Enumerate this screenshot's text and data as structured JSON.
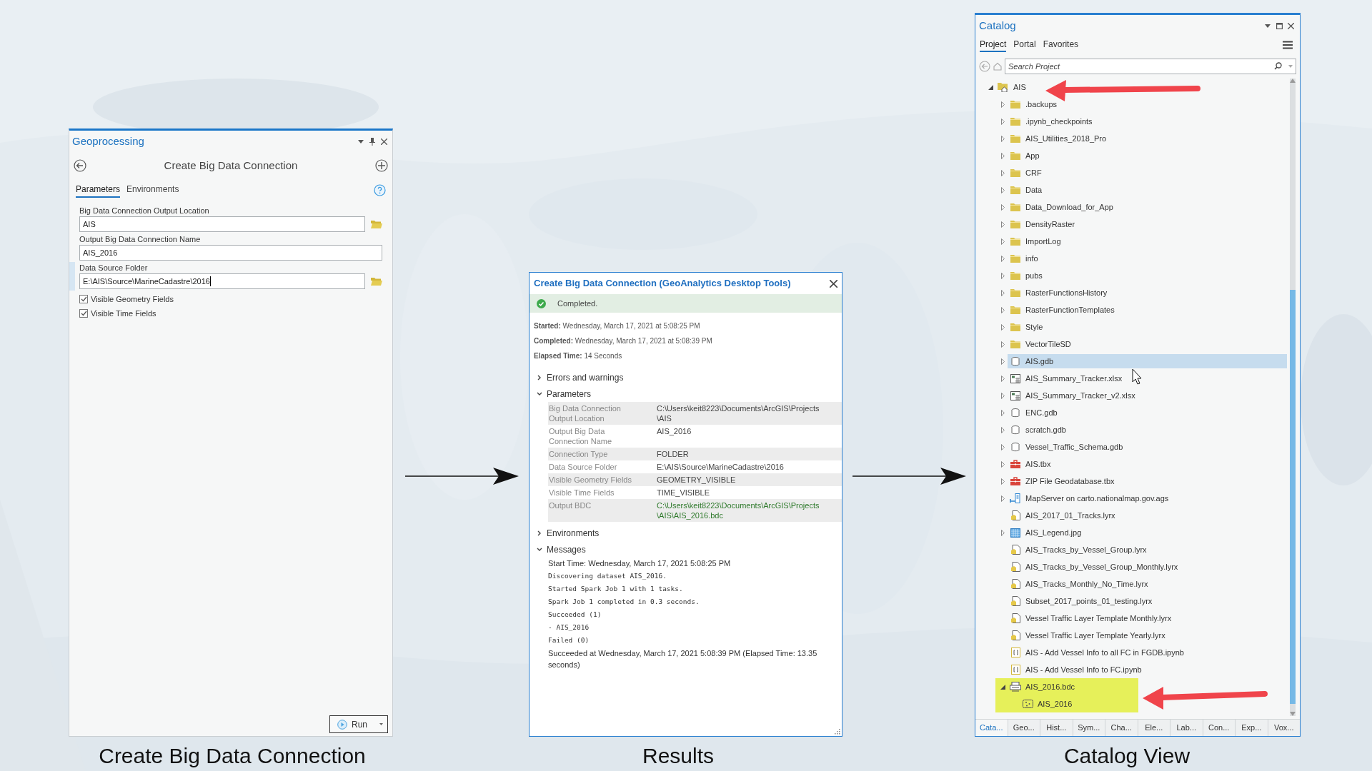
{
  "geoprocessing": {
    "title": "Geoprocessing",
    "tool_title": "Create Big Data Connection",
    "tabs": [
      {
        "label": "Parameters",
        "selected": true
      },
      {
        "label": "Environments",
        "selected": false
      }
    ],
    "parameters": [
      {
        "label": "Big Data Connection Output Location",
        "value": "AIS",
        "browse": true,
        "focused": false
      },
      {
        "label": "Output Big Data Connection Name",
        "value": "AIS_2016",
        "browse": false,
        "focused": false
      },
      {
        "label": "Data Source Folder",
        "value": "E:\\AIS\\Source\\MarineCadastre\\2016",
        "browse": true,
        "focused": true
      }
    ],
    "checkboxes": [
      {
        "label": "Visible Geometry Fields",
        "checked": true
      },
      {
        "label": "Visible Time Fields",
        "checked": true
      }
    ],
    "run_button": "Run"
  },
  "results": {
    "title": "Create Big Data Connection (GeoAnalytics Desktop Tools)",
    "status": "Completed.",
    "summary": [
      {
        "label": "Started:",
        "value": "Wednesday, March 17, 2021 at 5:08:25 PM"
      },
      {
        "label": "Completed:",
        "value": "Wednesday, March 17, 2021 at 5:08:39 PM"
      },
      {
        "label": "Elapsed Time:",
        "value": "14 Seconds"
      }
    ],
    "sections": [
      {
        "label": "Errors and warnings",
        "expanded": false
      },
      {
        "label": "Parameters",
        "expanded": true,
        "kind": "table",
        "rows": [
          {
            "label": "Big Data Connection Output Location",
            "value": "C:\\Users\\keit8223\\Documents\\ArcGIS\\Projects\\AIS",
            "kind": "input"
          },
          {
            "label": "Output Big Data Connection Name",
            "value": "AIS_2016",
            "kind": "input"
          },
          {
            "label": "Connection Type",
            "value": "FOLDER",
            "kind": "input"
          },
          {
            "label": "Data Source Folder",
            "value": "E:\\AIS\\Source\\MarineCadastre\\2016",
            "kind": "input"
          },
          {
            "label": "Visible Geometry Fields",
            "value": "GEOMETRY_VISIBLE",
            "kind": "input"
          },
          {
            "label": "Visible Time Fields",
            "value": "TIME_VISIBLE",
            "kind": "input"
          },
          {
            "label": "Output BDC",
            "value": "C:\\Users\\keit8223\\Documents\\ArcGIS\\Projects\\AIS\\AIS_2016.bdc",
            "kind": "output"
          }
        ]
      },
      {
        "label": "Environments",
        "expanded": false
      },
      {
        "label": "Messages",
        "expanded": true,
        "kind": "messages",
        "messages": [
          {
            "text": "Start Time: Wednesday, March 17, 2021 5:08:25 PM",
            "kind": "text"
          },
          {
            "text": "Discovering dataset AIS_2016.",
            "kind": "mono"
          },
          {
            "text": "Started Spark Job 1 with 1 tasks.",
            "kind": "mono"
          },
          {
            "text": "Spark Job 1 completed in 0.3 seconds.",
            "kind": "mono"
          },
          {
            "text": "Succeeded (1)",
            "kind": "mono"
          },
          {
            "text": "- AIS_2016",
            "kind": "mono"
          },
          {
            "text": "Failed (0)",
            "kind": "mono"
          },
          {
            "text": "Succeeded at Wednesday, March 17, 2021 5:08:39 PM (Elapsed Time: 13.35 seconds)",
            "kind": "text"
          }
        ]
      }
    ]
  },
  "catalog": {
    "title": "Catalog",
    "tabs": [
      {
        "label": "Project",
        "selected": true
      },
      {
        "label": "Portal",
        "selected": false
      },
      {
        "label": "Favorites",
        "selected": false
      }
    ],
    "search": {
      "placeholder": "Search Project"
    },
    "tree": [
      {
        "label": "AIS",
        "kind": "project-folder",
        "has_children": true,
        "expanded": true,
        "selected": false,
        "highlighted": false,
        "children": [
          {
            "label": ".backups",
            "kind": "folder",
            "has_children": true,
            "expanded": false,
            "selected": false,
            "highlighted": false
          },
          {
            "label": ".ipynb_checkpoints",
            "kind": "folder",
            "has_children": true,
            "expanded": false,
            "selected": false,
            "highlighted": false
          },
          {
            "label": "AIS_Utilities_2018_Pro",
            "kind": "folder",
            "has_children": true,
            "expanded": false,
            "selected": false,
            "highlighted": false
          },
          {
            "label": "App",
            "kind": "folder",
            "has_children": true,
            "expanded": false,
            "selected": false,
            "highlighted": false
          },
          {
            "label": "CRF",
            "kind": "folder",
            "has_children": true,
            "expanded": false,
            "selected": false,
            "highlighted": false
          },
          {
            "label": "Data",
            "kind": "folder",
            "has_children": true,
            "expanded": false,
            "selected": false,
            "highlighted": false
          },
          {
            "label": "Data_Download_for_App",
            "kind": "folder",
            "has_children": true,
            "expanded": false,
            "selected": false,
            "highlighted": false
          },
          {
            "label": "DensityRaster",
            "kind": "folder",
            "has_children": true,
            "expanded": false,
            "selected": false,
            "highlighted": false
          },
          {
            "label": "ImportLog",
            "kind": "folder",
            "has_children": true,
            "expanded": false,
            "selected": false,
            "highlighted": false
          },
          {
            "label": "info",
            "kind": "folder",
            "has_children": true,
            "expanded": false,
            "selected": false,
            "highlighted": false
          },
          {
            "label": "pubs",
            "kind": "folder",
            "has_children": true,
            "expanded": false,
            "selected": false,
            "highlighted": false
          },
          {
            "label": "RasterFunctionsHistory",
            "kind": "folder",
            "has_children": true,
            "expanded": false,
            "selected": false,
            "highlighted": false
          },
          {
            "label": "RasterFunctionTemplates",
            "kind": "folder",
            "has_children": true,
            "expanded": false,
            "selected": false,
            "highlighted": false
          },
          {
            "label": "Style",
            "kind": "folder",
            "has_children": true,
            "expanded": false,
            "selected": false,
            "highlighted": false
          },
          {
            "label": "VectorTileSD",
            "kind": "folder",
            "has_children": true,
            "expanded": false,
            "selected": false,
            "highlighted": false
          },
          {
            "label": "AIS.gdb",
            "kind": "gdb",
            "has_children": true,
            "expanded": false,
            "selected": true,
            "highlighted": false
          },
          {
            "label": "AIS_Summary_Tracker.xlsx",
            "kind": "xlsx",
            "has_children": true,
            "expanded": false,
            "selected": false,
            "highlighted": false
          },
          {
            "label": "AIS_Summary_Tracker_v2.xlsx",
            "kind": "xlsx",
            "has_children": true,
            "expanded": false,
            "selected": false,
            "highlighted": false
          },
          {
            "label": "ENC.gdb",
            "kind": "gdb",
            "has_children": true,
            "expanded": false,
            "selected": false,
            "highlighted": false
          },
          {
            "label": "scratch.gdb",
            "kind": "gdb",
            "has_children": true,
            "expanded": false,
            "selected": false,
            "highlighted": false
          },
          {
            "label": "Vessel_Traffic_Schema.gdb",
            "kind": "gdb",
            "has_children": true,
            "expanded": false,
            "selected": false,
            "highlighted": false
          },
          {
            "label": "AIS.tbx",
            "kind": "tbx",
            "has_children": true,
            "expanded": false,
            "selected": false,
            "highlighted": false
          },
          {
            "label": "ZIP File Geodatabase.tbx",
            "kind": "tbx",
            "has_children": true,
            "expanded": false,
            "selected": false,
            "highlighted": false
          },
          {
            "label": "MapServer on carto.nationalmap.gov.ags",
            "kind": "server",
            "has_children": true,
            "expanded": false,
            "selected": false,
            "highlighted": false
          },
          {
            "label": "AIS_2017_01_Tracks.lyrx",
            "kind": "lyrx",
            "has_children": false,
            "selected": false,
            "highlighted": false
          },
          {
            "label": "AIS_Legend.jpg",
            "kind": "jpg",
            "has_children": true,
            "expanded": false,
            "selected": false,
            "highlighted": false
          },
          {
            "label": "AIS_Tracks_by_Vessel_Group.lyrx",
            "kind": "lyrx",
            "has_children": false,
            "selected": false,
            "highlighted": false
          },
          {
            "label": "AIS_Tracks_by_Vessel_Group_Monthly.lyrx",
            "kind": "lyrx",
            "has_children": false,
            "selected": false,
            "highlighted": false
          },
          {
            "label": "AIS_Tracks_Monthly_No_Time.lyrx",
            "kind": "lyrx",
            "has_children": false,
            "selected": false,
            "highlighted": false
          },
          {
            "label": "Subset_2017_points_01_testing.lyrx",
            "kind": "lyrx",
            "has_children": false,
            "selected": false,
            "highlighted": false
          },
          {
            "label": "Vessel Traffic Layer Template Monthly.lyrx",
            "kind": "lyrx",
            "has_children": false,
            "selected": false,
            "highlighted": false
          },
          {
            "label": "Vessel Traffic Layer Template Yearly.lyrx",
            "kind": "lyrx",
            "has_children": false,
            "selected": false,
            "highlighted": false
          },
          {
            "label": "AIS - Add Vessel Info to all FC in FGDB.ipynb",
            "kind": "ipynb",
            "has_children": false,
            "selected": false,
            "highlighted": false
          },
          {
            "label": "AIS - Add Vessel Info to FC.ipynb",
            "kind": "ipynb",
            "has_children": false,
            "selected": false,
            "highlighted": false
          },
          {
            "label": "AIS_2016.bdc",
            "kind": "bdc",
            "has_children": true,
            "expanded": true,
            "selected": false,
            "highlighted": true,
            "children": [
              {
                "label": "AIS_2016",
                "kind": "dataset",
                "has_children": false,
                "selected": false,
                "highlighted": true
              }
            ]
          }
        ]
      }
    ],
    "bottom_tabs": [
      {
        "label": "Cata...",
        "selected": true
      },
      {
        "label": "Geo...",
        "selected": false
      },
      {
        "label": "Hist...",
        "selected": false
      },
      {
        "label": "Sym...",
        "selected": false
      },
      {
        "label": "Cha...",
        "selected": false
      },
      {
        "label": "Ele...",
        "selected": false
      },
      {
        "label": "Lab...",
        "selected": false
      },
      {
        "label": "Con...",
        "selected": false
      },
      {
        "label": "Exp...",
        "selected": false
      },
      {
        "label": "Vox...",
        "selected": false
      }
    ]
  },
  "captions": [
    "Create Big Data Connection",
    "Results",
    "Catalog View"
  ]
}
